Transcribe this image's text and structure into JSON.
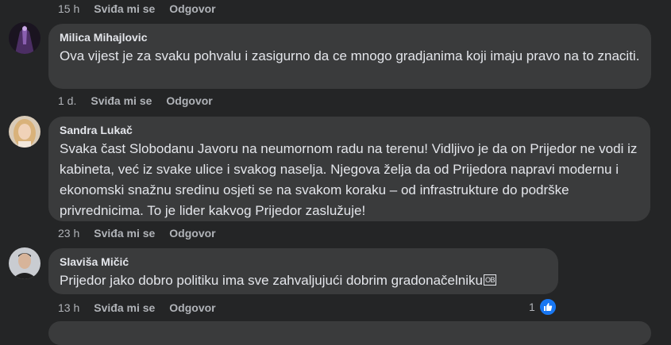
{
  "comments": [
    {
      "time": "15 h",
      "like_label": "Sviđa mi se",
      "reply_label": "Odgovor"
    },
    {
      "author": "Milica Mihajlovic",
      "text": "Ova vijest je za svaku pohvalu i zasigurno da ce mnogo gradjanima koji imaju pravo na to znaciti.",
      "time": "1 d.",
      "like_label": "Sviđa mi se",
      "reply_label": "Odgovor"
    },
    {
      "author": "Sandra Lukač",
      "text": "Svaka čast Slobodanu Javoru na neumornom radu na terenu! Vidljivo je da on Prijedor ne vodi iz kabineta, već iz svake ulice i svakog naselja. Njegova želja da od Prijedora napravi modernu i ekonomski snažnu sredinu osjeti se na svakom koraku – od infrastrukture do podrške privrednicima. To je lider kakvog Prijedor zaslužuje!",
      "time": "23 h",
      "like_label": "Sviđa mi se",
      "reply_label": "Odgovor"
    },
    {
      "author": "Slaviša Mičić",
      "text": "Prijedor jako dobro politiku ima sve zahvaljujući dobrim gradonačelniku",
      "emoji_text": "OB",
      "time": "13 h",
      "like_label": "Sviđa mi se",
      "reply_label": "Odgovor",
      "reaction_count": "1"
    }
  ],
  "colors": {
    "background": "#242526",
    "bubble": "#3a3b3c",
    "text": "#e4e6eb",
    "meta": "#b0b3b8",
    "like_blue": "#1877f2"
  },
  "icons": {
    "reaction": "like-thumb-icon"
  }
}
